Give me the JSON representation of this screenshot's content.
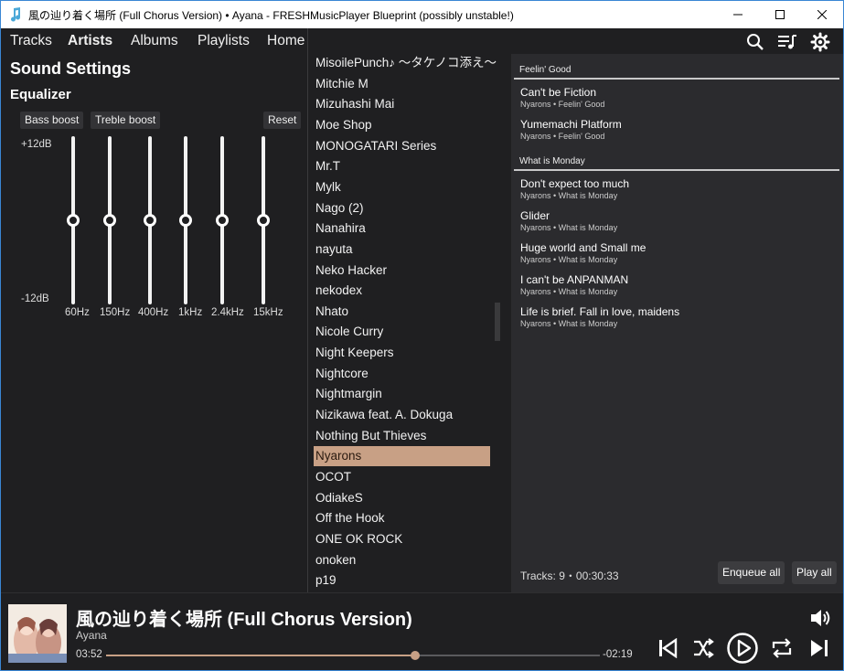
{
  "window": {
    "title": "風の辿り着く場所 (Full Chorus Version) • Ayana - FRESHMusicPlayer Blueprint (possibly unstable!)"
  },
  "nav": {
    "tabs": [
      "Tracks",
      "Artists",
      "Albums",
      "Playlists",
      "Home"
    ],
    "active": "Artists",
    "icons": [
      "search-icon",
      "queue-icon",
      "gear-icon"
    ]
  },
  "sound_settings": {
    "title": "Sound Settings",
    "equalizer_label": "Equalizer",
    "bass_boost": "Bass boost",
    "treble_boost": "Treble boost",
    "reset": "Reset",
    "max_label": "+12dB",
    "min_label": "-12dB",
    "bands": [
      {
        "label": "60Hz",
        "gain_db": 0
      },
      {
        "label": "150Hz",
        "gain_db": 0
      },
      {
        "label": "400Hz",
        "gain_db": 0
      },
      {
        "label": "1kHz",
        "gain_db": 0
      },
      {
        "label": "2.4kHz",
        "gain_db": 0
      },
      {
        "label": "15kHz",
        "gain_db": 0
      }
    ]
  },
  "artists": {
    "items": [
      "MisoilePunch♪ 〜タケノコ添え〜",
      "Mitchie M",
      "Mizuhashi Mai",
      "Moe Shop",
      "MONOGATARI Series",
      "Mr.T",
      "Mylk",
      "Nago (2)",
      "Nanahira",
      "nayuta",
      "Neko Hacker",
      "nekodex",
      "Nhato",
      "Nicole Curry",
      "Night Keepers",
      "Nightcore",
      "Nightmargin",
      "Nizikawa feat. A. Dokuga",
      "Nothing But Thieves",
      "Nyarons",
      "OCOT",
      "OdiakeS",
      "Off the Hook",
      "ONE OK ROCK",
      "onoken",
      "p19"
    ],
    "selected": "Nyarons"
  },
  "tracks": {
    "groups": [
      {
        "album": "Feelin' Good",
        "items": [
          {
            "title": "Can't be Fiction",
            "sub": "Nyarons • Feelin' Good"
          },
          {
            "title": "Yumemachi Platform",
            "sub": "Nyarons • Feelin' Good"
          }
        ]
      },
      {
        "album": "What is Monday",
        "items": [
          {
            "title": "Don't expect too much",
            "sub": "Nyarons • What is Monday"
          },
          {
            "title": "Glider",
            "sub": "Nyarons • What is Monday"
          },
          {
            "title": "Huge world and Small me",
            "sub": "Nyarons • What is Monday"
          },
          {
            "title": "I can't be ANPANMAN",
            "sub": "Nyarons • What is Monday"
          },
          {
            "title": "Life is brief. Fall in love, maidens",
            "sub": "Nyarons • What is Monday"
          }
        ]
      }
    ],
    "summary": "Tracks: 9・00:30:33",
    "enqueue_all": "Enqueue all",
    "play_all": "Play all"
  },
  "player": {
    "title": "風の辿り着く場所 (Full Chorus Version)",
    "artist": "Ayana",
    "elapsed": "03:52",
    "remaining": "-02:19",
    "progress_fraction": 0.625,
    "accent": "#c8a085",
    "controls": [
      "previous-icon",
      "shuffle-icon",
      "play-icon",
      "repeat-icon",
      "next-icon",
      "volume-icon"
    ]
  }
}
